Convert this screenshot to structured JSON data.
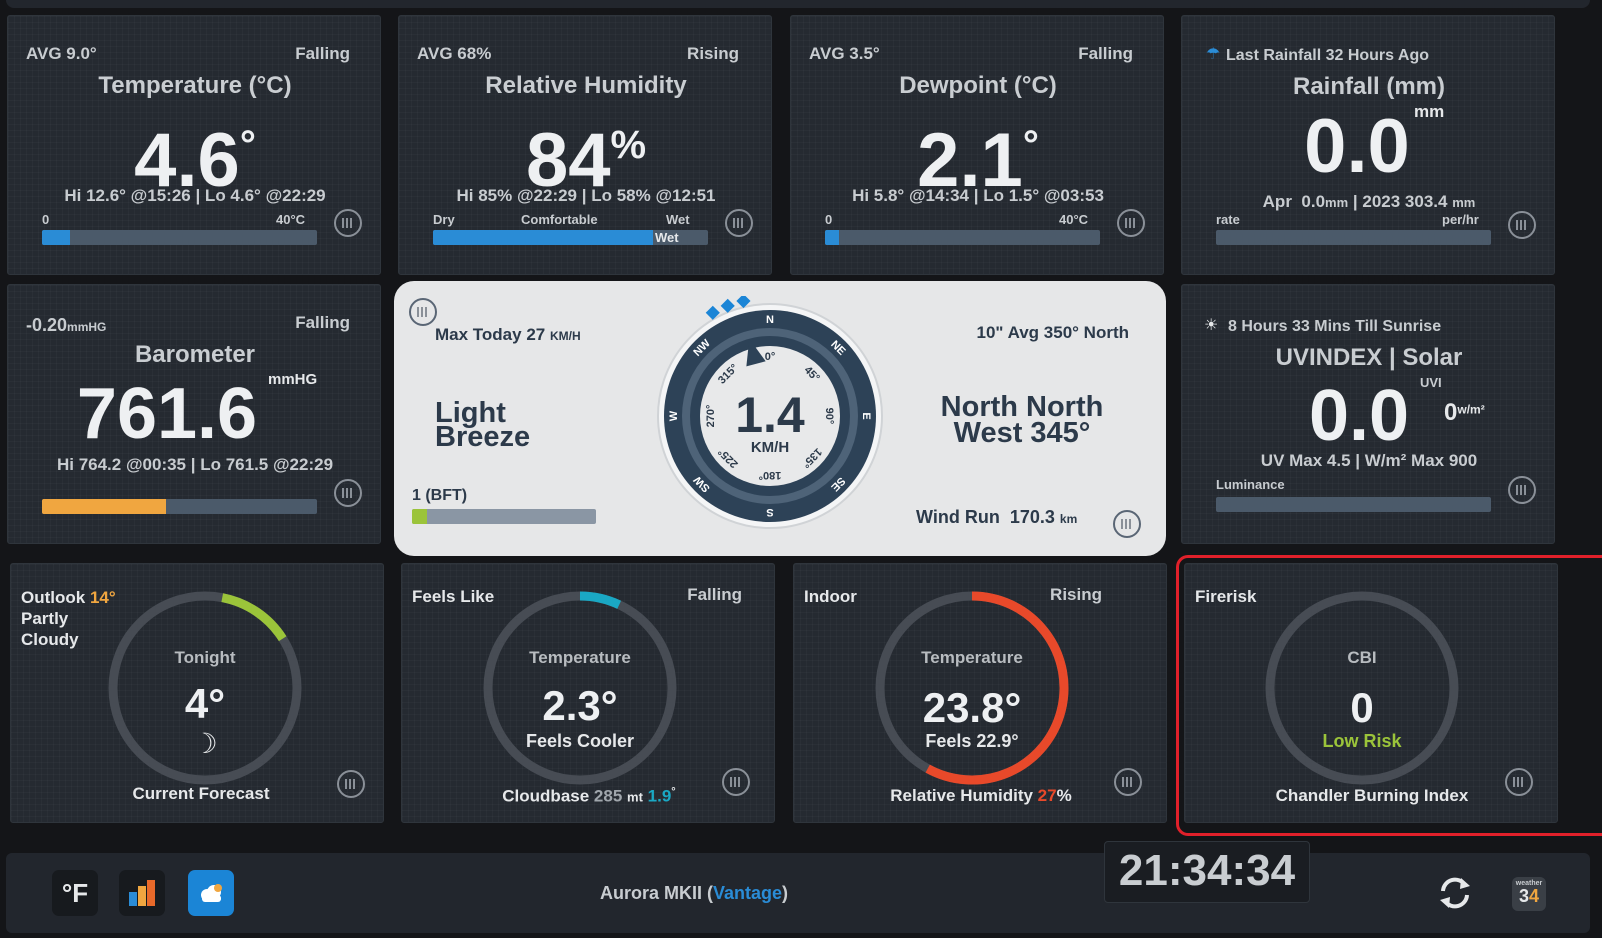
{
  "temperature": {
    "avg": "AVG 9.0°",
    "trend": "Falling",
    "title": "Temperature (°C)",
    "value": "4.6",
    "unit": "°",
    "hilo": "Hi 12.6° @15:26 | Lo 4.6° @22:29",
    "scale_min": "0",
    "scale_max": "40°C",
    "level": 0.1,
    "bar_color": "#2a8cd6"
  },
  "humidity": {
    "avg": "AVG 68%",
    "trend": "Rising",
    "title": "Relative Humidity",
    "value": "84",
    "unit": "%",
    "hilo": "Hi 85% @22:29 | Lo 58% @12:51",
    "label_dry": "Dry",
    "label_comfort": "Comfortable",
    "label_wet": "Wet",
    "bar_label": "Wet",
    "level": 0.8,
    "bar_color": "#2a8cd6"
  },
  "dewpoint": {
    "avg": "AVG 3.5°",
    "trend": "Falling",
    "title": "Dewpoint (°C)",
    "value": "2.1",
    "unit": "°",
    "hilo": "Hi 5.8° @14:34 | Lo 1.5° @03:53",
    "scale_min": "0",
    "scale_max": "40°C",
    "level": 0.05,
    "bar_color": "#2a8cd6"
  },
  "rainfall": {
    "icon": "umbrella-icon",
    "last": "Last Rainfall 32 Hours Ago",
    "title": "Rainfall (mm)",
    "value": "0.0",
    "unit": "mm",
    "month_label": "Apr",
    "month_value": "0.0",
    "month_unit": "mm",
    "year_label": "2023",
    "year_value": "303.4",
    "year_unit": "mm",
    "rate_label": "rate",
    "perhr_label": "per/hr",
    "level": 0
  },
  "barometer": {
    "change": "-0.20",
    "change_unit": "mmHG",
    "trend": "Falling",
    "title": "Barometer",
    "value": "761.6",
    "unit": "mmHG",
    "hilo": "Hi 764.2 @00:35 | Lo 761.5 @22:29",
    "level": 0.45,
    "bar_color": "#f0a640"
  },
  "wind": {
    "max_today_label": "Max Today",
    "max_today_value": "27",
    "max_today_unit": "KM/H",
    "avg": "10\" Avg 350° North",
    "description_line1": "Light",
    "description_line2": "Breeze",
    "speed": "1.4",
    "speed_unit": "KM/H",
    "direction_line1": "North North",
    "direction_line2": "West 345°",
    "bft_label": "1 (BFT)",
    "bft_level": 0.08,
    "bft_color": "#9bc43a",
    "run_label": "Wind Run",
    "run_value": "170.3",
    "run_unit": "km",
    "compass_points": [
      "N",
      "NE",
      "E",
      "SE",
      "S",
      "SW",
      "W",
      "NW"
    ],
    "degree_labels": [
      "0°",
      "45°",
      "90°",
      "135°",
      "180°",
      "225°",
      "270°",
      "315°"
    ],
    "heading_deg": 345
  },
  "uv": {
    "icon": "sun-icon",
    "sunrise": "8 Hours 33 Mins Till Sunrise",
    "title": "UVINDEX | Solar",
    "value": "0.0",
    "unit": "UVI",
    "solar_value": "0",
    "solar_unit": "w/m²",
    "max_text": "UV Max 4.5 | W/m² Max 900",
    "luminance_label": "Luminance",
    "level": 0
  },
  "outlook": {
    "label": "Outlook",
    "temp": "14°",
    "condition_line1": "Partly",
    "condition_line2": "Cloudy",
    "period": "Tonight",
    "value": "4°",
    "icon": "moon-icon",
    "footer": "Current Forecast",
    "arc_color": "#9bc43a",
    "arc_start": 0.03,
    "arc_end": 0.16
  },
  "feels_like": {
    "label": "Feels Like",
    "trend": "Falling",
    "subtitle": "Temperature",
    "value": "2.3°",
    "status": "Feels Cooler",
    "footer_label": "Cloudbase",
    "cloudbase_value": "285",
    "cloudbase_unit": "mt",
    "cloudbase_temp": "1.9",
    "cloudbase_deg": "°",
    "arc_color": "#1aa8c4",
    "arc_start": 0.0,
    "arc_end": 0.07
  },
  "indoor": {
    "label": "Indoor",
    "trend": "Rising",
    "subtitle": "Temperature",
    "value": "23.8°",
    "feels": "Feels 22.9°",
    "footer_label": "Relative Humidity",
    "humidity_value": "27",
    "humidity_unit": "%",
    "arc_color": "#e8492a",
    "arc_start": 0.0,
    "arc_end": 0.58
  },
  "firerisk": {
    "label": "Firerisk",
    "subtitle": "CBI",
    "value": "0",
    "status": "Low Risk",
    "status_color": "#9bc43a",
    "footer": "Chandler Burning Index",
    "highlight_color": "#e0202a"
  },
  "footer": {
    "units_button": "°F",
    "station_name": "Aurora MKII (",
    "station_model": "Vantage",
    "station_close": ")",
    "clock": "21:34:34",
    "logo_top": "weather",
    "logo_num_a": "3",
    "logo_num_b": "4",
    "accent": "#2a8cd6"
  }
}
